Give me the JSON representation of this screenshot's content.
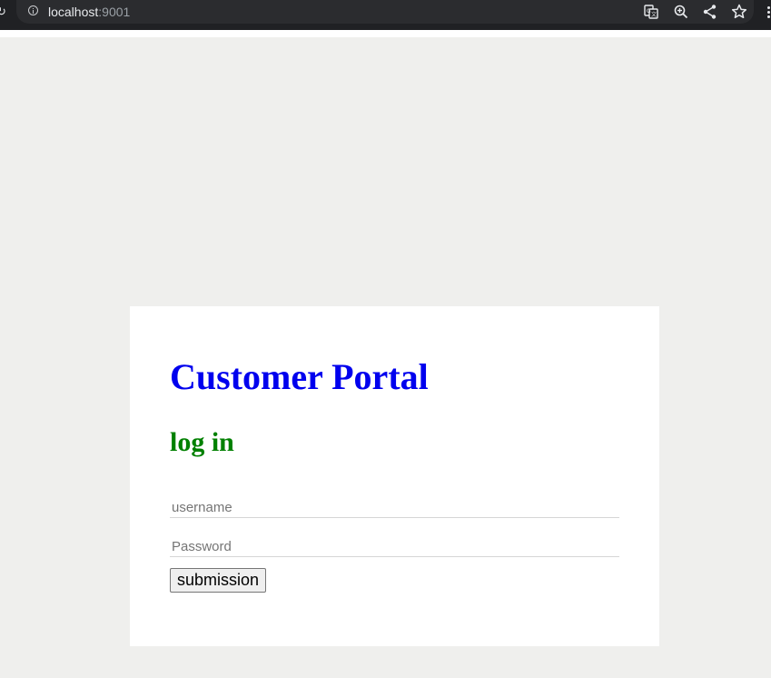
{
  "browser": {
    "url_host": "localhost",
    "url_port": ":9001",
    "icons": [
      "info-icon",
      "translate-icon",
      "zoom-icon",
      "share-icon",
      "star-icon",
      "menu-icon"
    ]
  },
  "login": {
    "title": "Customer Portal",
    "subtitle": "log in",
    "username_placeholder": "username",
    "password_placeholder": "Password",
    "submit_label": "submission"
  },
  "colors": {
    "title": "#0000ee",
    "subtitle": "#008000",
    "page_background": "#efefed",
    "card_background": "#ffffff",
    "chrome_background": "#202124"
  }
}
